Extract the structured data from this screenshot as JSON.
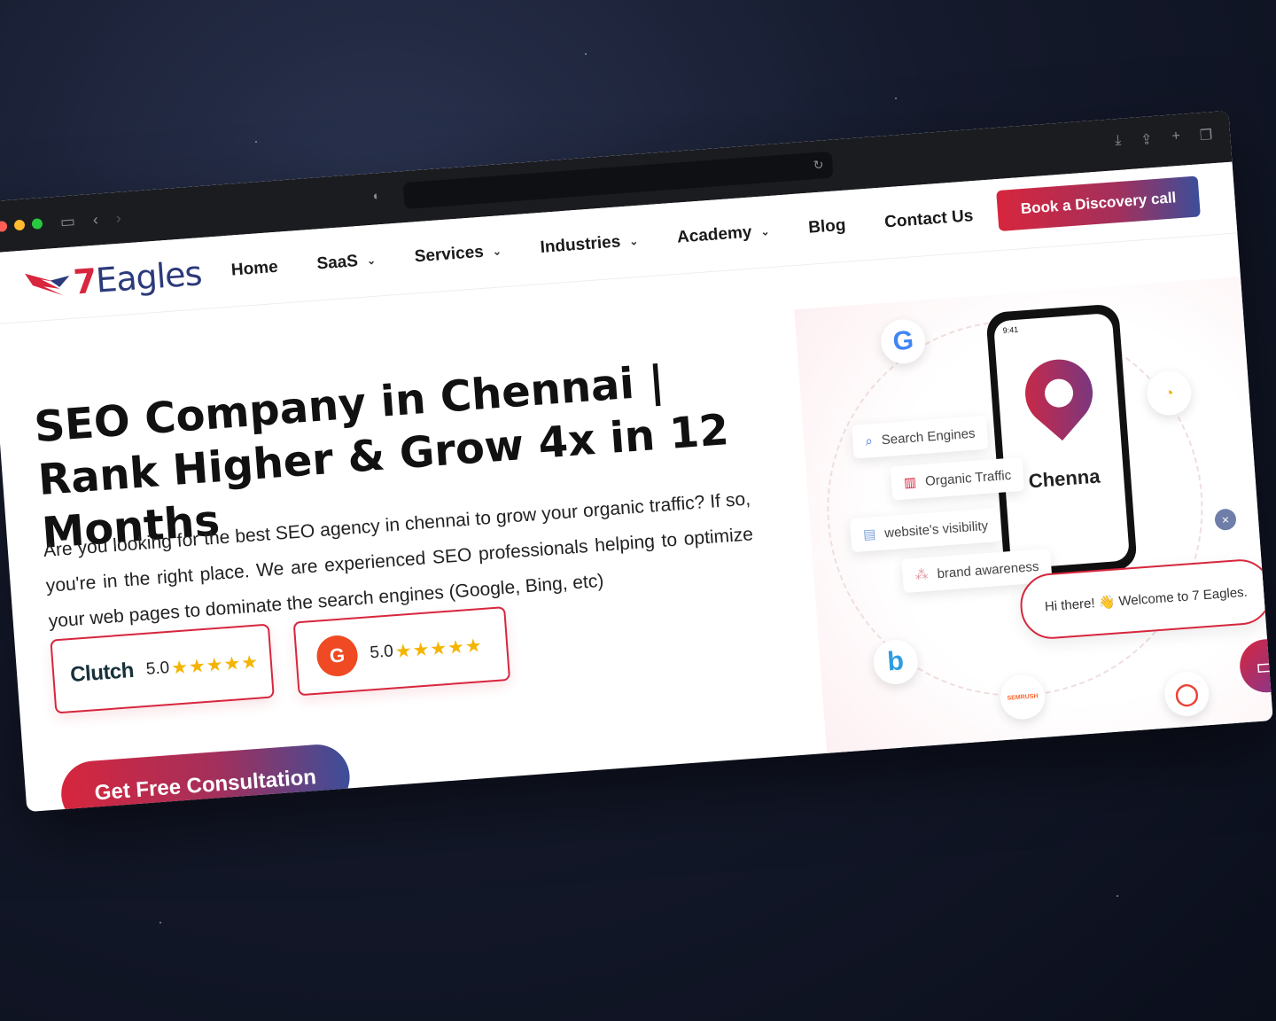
{
  "browser": {
    "address_bar_text": ""
  },
  "nav": {
    "logo_text_prefix": "7",
    "logo_text_main": "Eagles",
    "items": [
      {
        "label": "Home",
        "has_dropdown": false
      },
      {
        "label": "SaaS",
        "has_dropdown": true
      },
      {
        "label": "Services",
        "has_dropdown": true
      },
      {
        "label": "Industries",
        "has_dropdown": true
      },
      {
        "label": "Academy",
        "has_dropdown": true
      },
      {
        "label": "Blog",
        "has_dropdown": false
      },
      {
        "label": "Contact Us",
        "has_dropdown": false
      }
    ],
    "cta_label": "Book a Discovery call"
  },
  "hero": {
    "title": "SEO Company in Chennai | Rank Higher & Grow 4x in 12 Months",
    "description": "Are you looking for the best SEO agency in chennai to grow your organic traffic? If so, you're in the right place. We are experienced SEO professionals helping to optimize your web pages to dominate the search engines (Google, Bing, etc)",
    "badges": {
      "clutch": {
        "brand": "Clutch",
        "rating": "5.0",
        "stars": "★★★★★"
      },
      "g2": {
        "brand": "G",
        "rating": "5.0",
        "stars": "★★★★★"
      }
    },
    "cta_label": "Get Free Consultation"
  },
  "visual": {
    "phone_time": "9:41",
    "phone_city": "Chenna",
    "chips": [
      {
        "label": "Search Engines",
        "icon": "search-icon"
      },
      {
        "label": "Organic Traffic",
        "icon": "chart-icon"
      },
      {
        "label": "website's visibility",
        "icon": "browser-icon"
      },
      {
        "label": "brand awareness",
        "icon": "network-icon"
      }
    ],
    "bubbles": [
      {
        "label": "G",
        "icon": "google-icon",
        "color": "#4285f4"
      },
      {
        "label": "b",
        "icon": "bing-icon",
        "color": "#2b9de0"
      },
      {
        "label": "SEMRUSH",
        "icon": "semrush-icon",
        "color": "#ff642d"
      },
      {
        "label": "",
        "icon": "gauge-icon",
        "color": "#f4b400"
      },
      {
        "label": "",
        "icon": "ring-logo-icon",
        "color": "#ea4335"
      }
    ]
  },
  "chat": {
    "greeting": "Hi there! 👋 Welcome to 7 Eagles.",
    "close_symbol": "×"
  },
  "colors": {
    "brand_red": "#d7263d",
    "brand_blue": "#3c4e9a",
    "star_yellow": "#f4b400"
  }
}
